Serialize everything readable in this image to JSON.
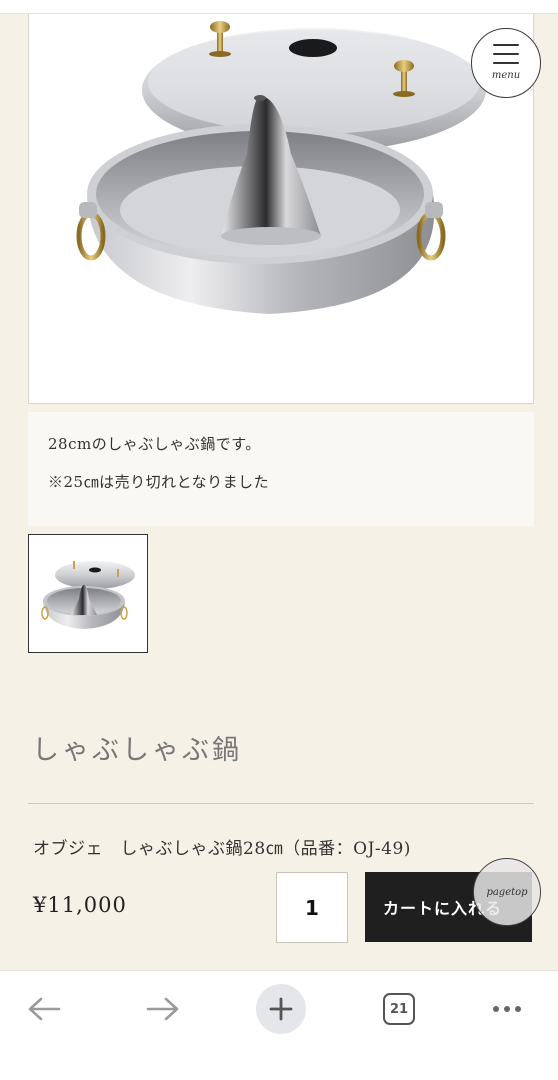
{
  "header": {
    "menu_label": "menu"
  },
  "product": {
    "main_image_alt": "しゃぶしゃぶ鍋",
    "description_line1": "28cmのしゃぶしゃぶ鍋です。",
    "description_line2": "※25㎝は売り切れとなりました",
    "title": "しゃぶしゃぶ鍋",
    "variant": "オブジェ　しゃぶしゃぶ鍋28㎝（品番：OJ-49)",
    "price": "¥11,000",
    "quantity": "1",
    "cart_button_label": "カートに入れる"
  },
  "pagetop_label": "pagetop",
  "browser": {
    "tab_count": "21"
  }
}
